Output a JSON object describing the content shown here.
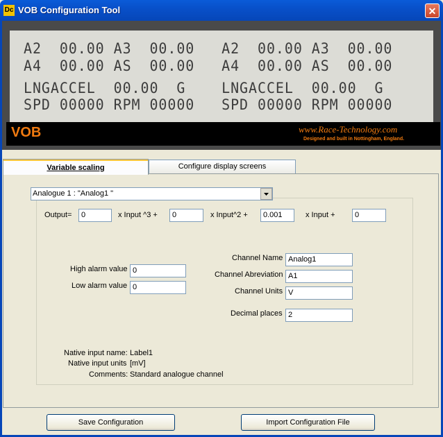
{
  "window": {
    "title": "VOB Configuration Tool",
    "app_icon_text": "Dc",
    "close_glyph": "✕"
  },
  "display": {
    "lcd_lines": [
      "A2  00.00 A3  00.00   A2  00.00 A3  00.00",
      "A4  00.00 AS  00.00   A4  00.00 AS  00.00",
      "LNGACCEL  00.00  G    LNGACCEL  00.00  G",
      "SPD 00000 RPM 00000   SPD 00000 RPM 00000"
    ],
    "brand": "VOB",
    "website": "www.Race-Technology.com",
    "tagline": "Designed and built in Nottingham, England."
  },
  "tabs": [
    {
      "label": "Variable scaling",
      "active": true
    },
    {
      "label": "Configure display screens",
      "active": false
    }
  ],
  "channel_select": {
    "selected": "Analogue 1 : \"Analog1 \""
  },
  "formula": {
    "output_label": "Output=",
    "c3": "0",
    "x3_label": "x  Input ^3 +",
    "c2": "0",
    "x2_label": "x  Input^2  +",
    "c1": "0.001",
    "x1_label": "x  Input  +",
    "c0": "0"
  },
  "alarms": {
    "high_label": "High alarm value",
    "high_value": "0",
    "low_label": "Low alarm value",
    "low_value": "0"
  },
  "channel": {
    "name_label": "Channel Name",
    "name_value": "Analog1",
    "abbrev_label": "Channel Abreviation",
    "abbrev_value": "A1",
    "units_label": "Channel Units",
    "units_value": "V",
    "decimals_label": "Decimal places",
    "decimals_value": "2"
  },
  "info": {
    "native_name_label": "Native input name:",
    "native_name_value": "Label1",
    "native_units_label": "Native input units",
    "native_units_value": "[mV]",
    "comments_label": "Comments:",
    "comments_value": "Standard analogue channel"
  },
  "buttons": {
    "save": "Save Configuration",
    "import": "Import Configuration File"
  },
  "colors": {
    "titlebar": "#0646b8",
    "brand_orange": "#f07a10",
    "lcd_bg": "#dcdcd6"
  }
}
